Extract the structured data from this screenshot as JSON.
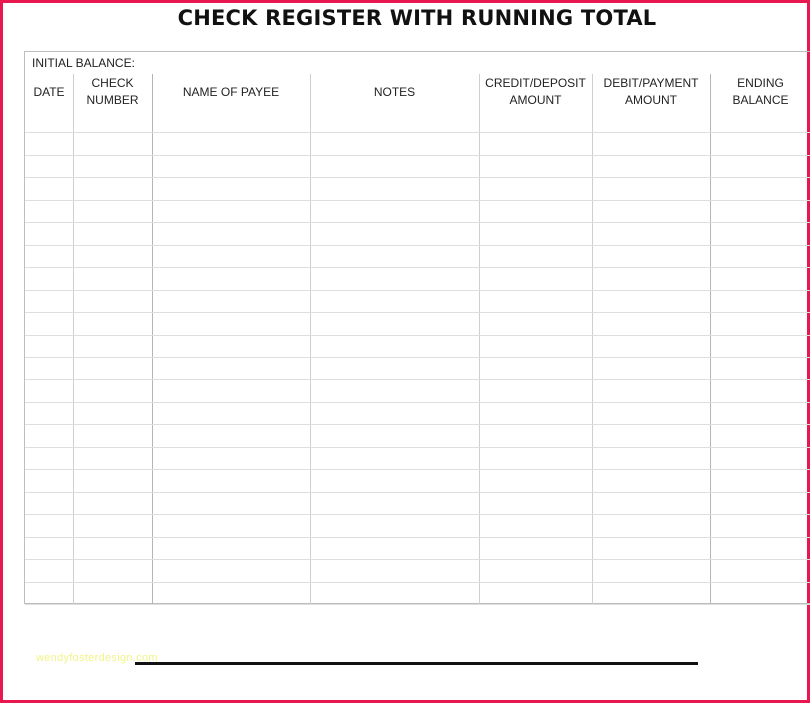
{
  "title": "CHECK REGISTER WITH RUNNING TOTAL",
  "initial_balance_label": "INITIAL BALANCE:",
  "columns": [
    {
      "label": "DATE"
    },
    {
      "label": "CHECK\nNUMBER"
    },
    {
      "label": "NAME OF PAYEE"
    },
    {
      "label": "NOTES"
    },
    {
      "label": "CREDIT/DEPOSIT\nAMOUNT"
    },
    {
      "label": "DEBIT/PAYMENT\nAMOUNT"
    },
    {
      "label": "ENDING\nBALANCE"
    }
  ],
  "row_count": 22,
  "watermark": "wendyfosterdesign.com",
  "colors": {
    "frame": "#e8174f",
    "watermark": "#f1f58a"
  }
}
